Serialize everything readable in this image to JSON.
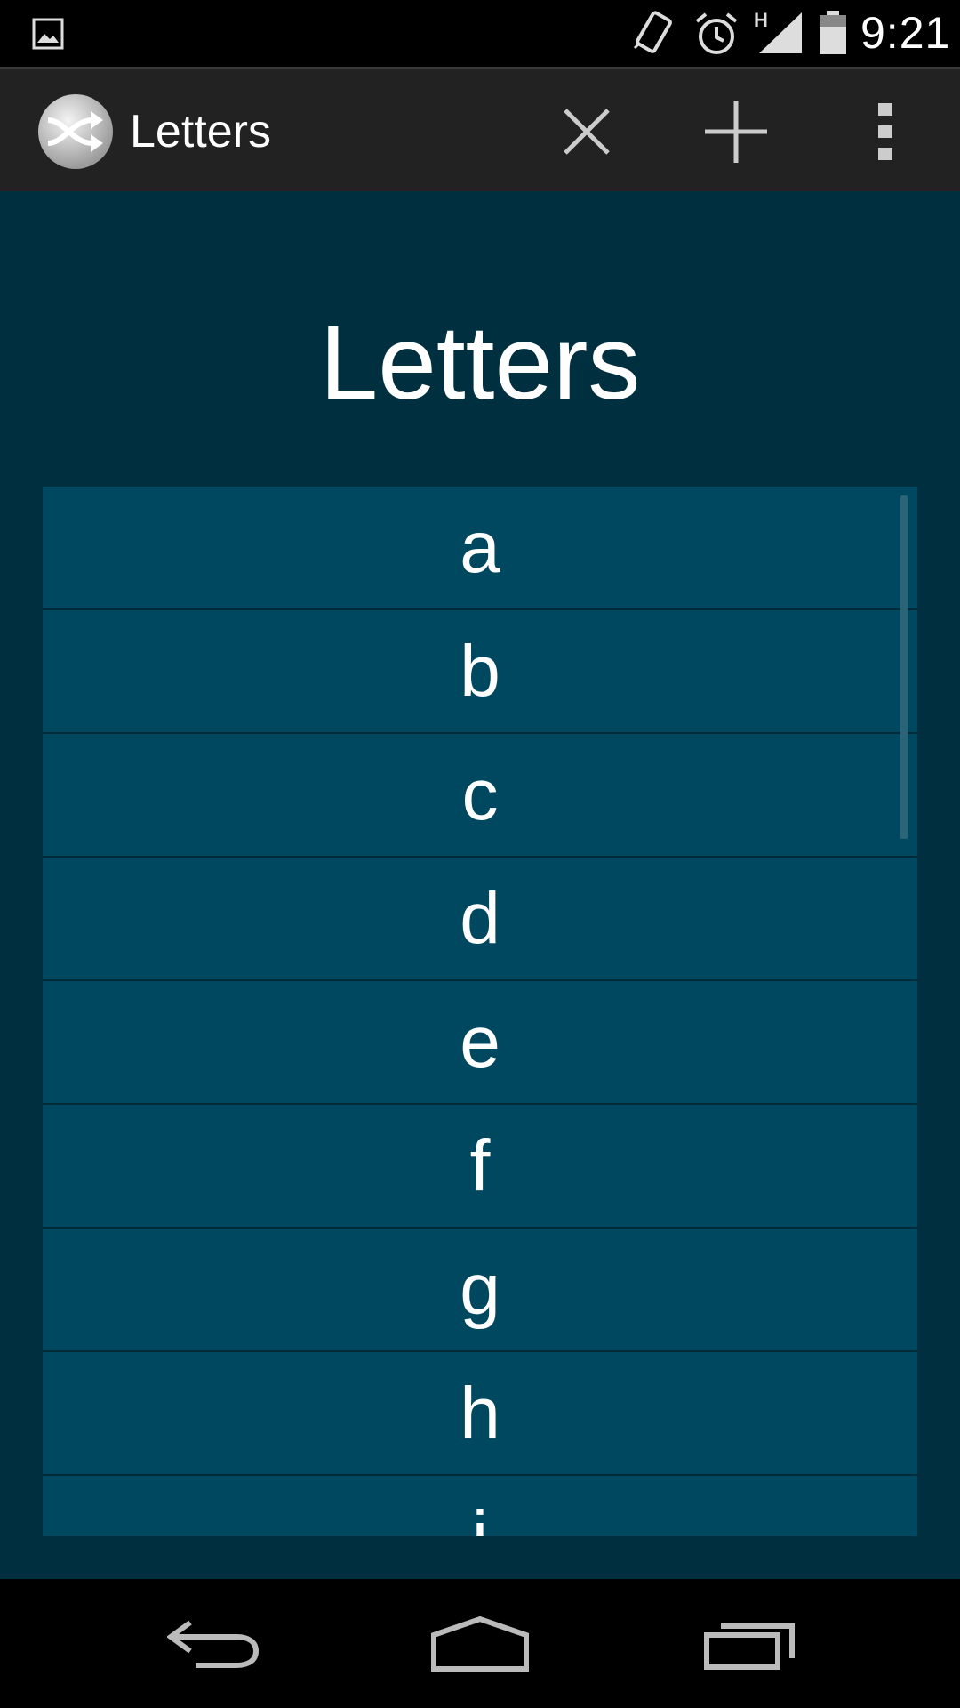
{
  "status_bar": {
    "time": "9:21",
    "network_type": "H",
    "icons": [
      "gallery-icon",
      "vibrate-icon",
      "alarm-icon",
      "signal-icon",
      "battery-icon"
    ]
  },
  "action_bar": {
    "title": "Letters",
    "actions": [
      "close-icon",
      "add-icon",
      "overflow-menu-icon"
    ]
  },
  "main": {
    "title": "Letters",
    "items": [
      "a",
      "b",
      "c",
      "d",
      "e",
      "f",
      "g",
      "h",
      "i"
    ]
  },
  "nav_bar": {
    "buttons": [
      "back-icon",
      "home-icon",
      "recents-icon"
    ]
  },
  "colors": {
    "action_bar_bg": "#222222",
    "content_bg": "#002f3f",
    "list_item_bg": "#00485f"
  }
}
